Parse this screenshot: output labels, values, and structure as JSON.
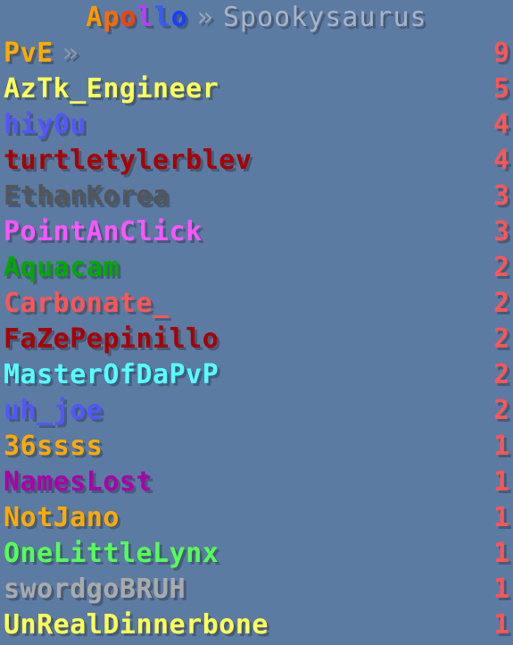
{
  "header": {
    "title_letters": [
      "A",
      "p",
      "o",
      "l",
      "l",
      "o"
    ],
    "title_colors": [
      "#ff9800",
      "#ff6a00",
      "#ff3f00",
      "#b83eff",
      "#3a5aff",
      "#1c3cff"
    ],
    "separator": "»",
    "subtitle": "Spookysaurus"
  },
  "section": {
    "label": "PvE",
    "arrow": "»",
    "score": "9",
    "color": "#ffaa00"
  },
  "players": [
    {
      "name": "AzTk_Engineer",
      "score": "5",
      "color": "#ffff55"
    },
    {
      "name": "hiy0u",
      "score": "4",
      "color": "#5555ff"
    },
    {
      "name": "turtletylerblev",
      "score": "4",
      "color": "#aa0000"
    },
    {
      "name": "EthanKorea",
      "score": "3",
      "color": "#555555"
    },
    {
      "name": "PointAnClick",
      "score": "3",
      "color": "#ff55ff"
    },
    {
      "name": "Aquacam",
      "score": "2",
      "color": "#00aa00"
    },
    {
      "name": "Carbonate_",
      "score": "2",
      "color": "#ff5555"
    },
    {
      "name": "FaZePepinillo",
      "score": "2",
      "color": "#aa0000"
    },
    {
      "name": "MasterOfDaPvP",
      "score": "2",
      "color": "#55ffff"
    },
    {
      "name": "uh_joe",
      "score": "2",
      "color": "#5555ff"
    },
    {
      "name": "36ssss",
      "score": "1",
      "color": "#ffaa00"
    },
    {
      "name": "NamesLost",
      "score": "1",
      "color": "#aa00aa"
    },
    {
      "name": "NotJano",
      "score": "1",
      "color": "#ffaa00"
    },
    {
      "name": "OneLittleLynx",
      "score": "1",
      "color": "#55ff55"
    },
    {
      "name": "swordgoBRUH",
      "score": "1",
      "color": "#aaaaaa"
    },
    {
      "name": "UnRealDinnerbone",
      "score": "1",
      "color": "#ffff55"
    }
  ],
  "score_color": "#ff5555"
}
